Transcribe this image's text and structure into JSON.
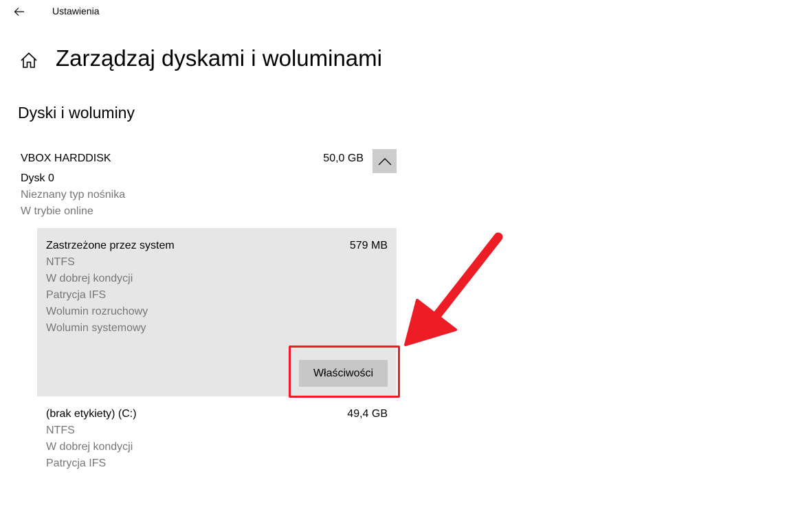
{
  "window": {
    "app_title": "Ustawienia"
  },
  "header": {
    "title": "Zarządzaj dyskami i woluminami"
  },
  "section": {
    "title": "Dyski i woluminy"
  },
  "disk": {
    "name": "VBOX HARDDISK",
    "size": "50,0 GB",
    "number": "Dysk 0",
    "media_type": "Nieznany typ nośnika",
    "status": "W trybie online"
  },
  "volumes": [
    {
      "name": "Zastrzeżone przez system",
      "size": "579 MB",
      "details": [
        "NTFS",
        "W dobrej kondycji",
        "Patrycja IFS",
        "Wolumin rozruchowy",
        "Wolumin systemowy"
      ],
      "properties_label": "Właściwości"
    },
    {
      "name": "(brak etykiety) (C:)",
      "size": "49,4 GB",
      "details": [
        "NTFS",
        "W dobrej kondycji",
        "Patrycja IFS"
      ]
    }
  ],
  "colors": {
    "selected_bg": "#e6e6e6",
    "button_bg": "#c6c6c6",
    "secondary_text": "#767676",
    "annotation_red": "#ee1c24"
  },
  "icons": {
    "back": "arrow-left-icon",
    "home": "home-icon",
    "collapse": "chevron-up-icon",
    "annotation": "red-arrow-icon"
  }
}
